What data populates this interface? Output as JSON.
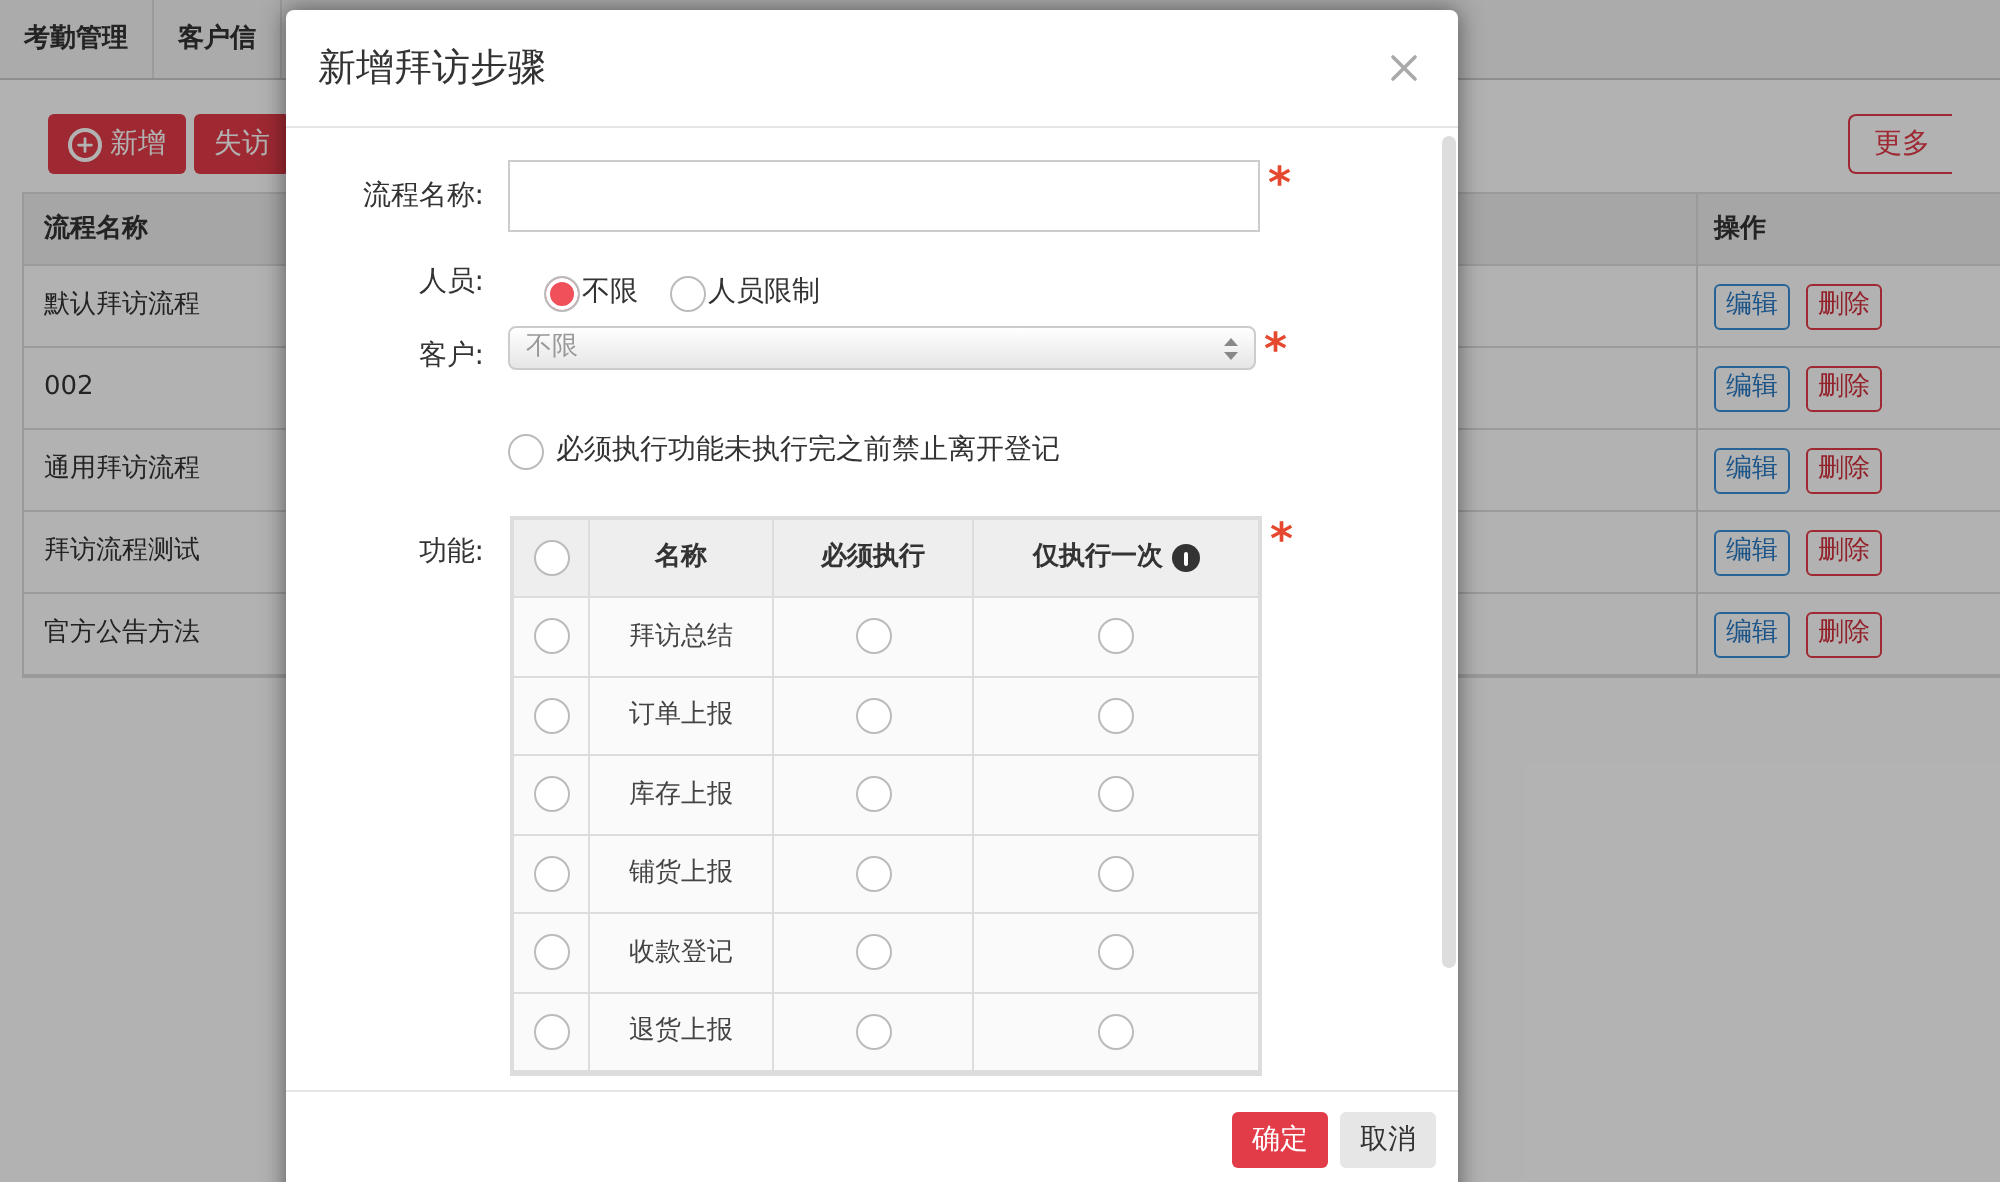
{
  "background": {
    "tabs": [
      {
        "label": "考勤管理",
        "selected": false
      },
      {
        "label": "客户信",
        "selected": false
      }
    ],
    "toolbar": [
      {
        "label": "新增",
        "kind": "add"
      },
      {
        "label": "失访",
        "kind": "plain"
      }
    ],
    "more_button": "更多",
    "table": {
      "columns": [
        "流程名称",
        "操作"
      ],
      "rows": [
        {
          "name": "默认拜访流程",
          "actions": [
            "编辑",
            "删除"
          ]
        },
        {
          "name": "002",
          "actions": [
            "编辑",
            "删除"
          ]
        },
        {
          "name": "通用拜访流程",
          "actions": [
            "编辑",
            "删除"
          ]
        },
        {
          "name": "拜访流程测试",
          "actions": [
            "编辑",
            "删除"
          ]
        },
        {
          "name": "官方公告方法",
          "actions": [
            "编辑",
            "删除"
          ]
        }
      ]
    }
  },
  "dialog": {
    "title": "新增拜访步骤",
    "name_field": {
      "label": "流程名称:",
      "required_mark": "*"
    },
    "personnel": {
      "label": "人员:",
      "options": [
        {
          "label": "不限",
          "selected": true
        },
        {
          "label": "人员限制",
          "selected": false
        }
      ]
    },
    "customer": {
      "label": "客户:",
      "value": "不限",
      "required_mark": "*"
    },
    "forbid_leave": {
      "label": "必须执行功能未执行完之前禁止离开登记",
      "checked": false
    },
    "functions": {
      "label": "功能:",
      "required_mark": "*",
      "all_selected": false,
      "columns": [
        "名称",
        "必须执行",
        "仅执行一次"
      ],
      "rows": [
        {
          "name": "拜访总结",
          "selected": false,
          "required": false,
          "once": false
        },
        {
          "name": "订单上报",
          "selected": false,
          "required": false,
          "once": false
        },
        {
          "name": "库存上报",
          "selected": false,
          "required": false,
          "once": false
        },
        {
          "name": "铺货上报",
          "selected": false,
          "required": false,
          "once": false
        },
        {
          "name": "收款登记",
          "selected": false,
          "required": false,
          "once": false
        },
        {
          "name": "退货上报",
          "selected": false,
          "required": false,
          "once": false
        }
      ]
    },
    "buttons": [
      {
        "label": "确定",
        "kind": "primary"
      },
      {
        "label": "取消",
        "kind": "default"
      }
    ]
  }
}
